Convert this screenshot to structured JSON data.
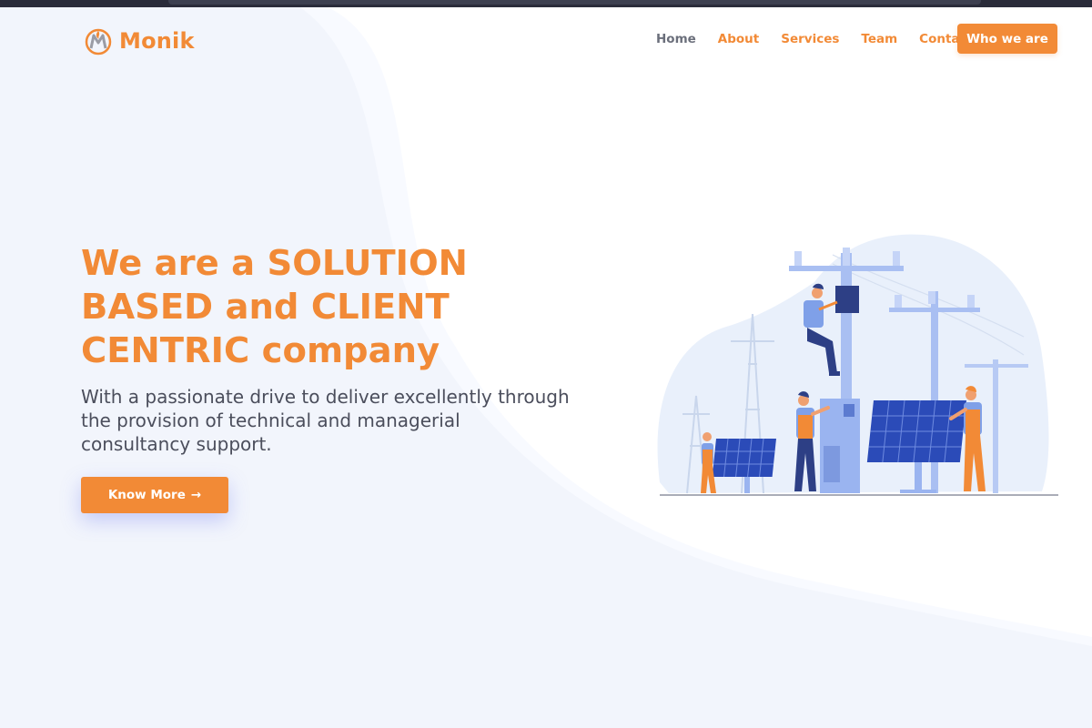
{
  "brand": {
    "name": "Monik",
    "logo_icon": "flame-m-logo-icon"
  },
  "nav": {
    "links": [
      {
        "label": "Home",
        "active": true
      },
      {
        "label": "About",
        "active": false
      },
      {
        "label": "Services",
        "active": false
      },
      {
        "label": "Team",
        "active": false
      },
      {
        "label": "Contact",
        "active": false
      }
    ],
    "cta_label": "Who we are"
  },
  "hero": {
    "title": "We are a SOLUTION BASED and CLIENT CENTRIC company",
    "subtitle": "With a passionate drive to deliver excellently through the provision of technical and managerial consultancy support.",
    "button_label": "Know More",
    "button_icon": "arrow-right-icon"
  },
  "illustration": {
    "subject": "workers-installing-solar-panels-and-power-lines-illustration"
  },
  "colors": {
    "accent": "#f28a36",
    "text": "#4b4e5c",
    "nav_muted": "#6b6f7b",
    "background_wave": "#f2f5fc"
  }
}
